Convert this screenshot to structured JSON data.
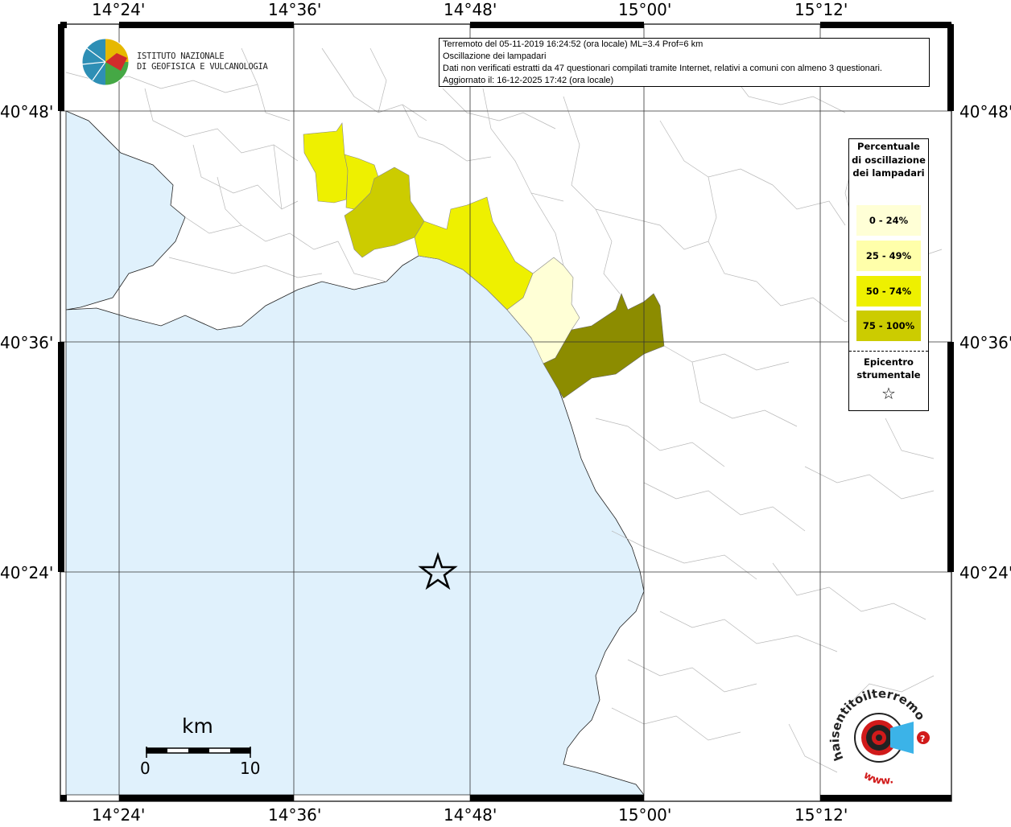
{
  "info": {
    "line1": "Terremoto del 05-11-2019 16:24:52 (ora locale) ML=3.4 Prof=6 km",
    "line2": "Oscillazione dei lampadari",
    "line3": "Dati non verificati estratti da 47 questionari compilati tramite Internet, relativi a comuni con almeno 3 questionari.",
    "line4": "Aggiornato il: 16-12-2025 17:42 (ora locale)"
  },
  "institute": {
    "line1": "ISTITUTO NAZIONALE",
    "line2": "DI GEOFISICA E VULCANOLOGIA"
  },
  "axes": {
    "lon_labels": [
      "14°24'",
      "14°36'",
      "14°48'",
      "15°00'",
      "15°12'"
    ],
    "lat_labels": [
      "40°48'",
      "40°36'",
      "40°24'"
    ]
  },
  "legend": {
    "title": "Percentuale di oscillazione dei lampadari",
    "classes": [
      {
        "label": "0 - 24%",
        "color": "#ffffd6"
      },
      {
        "label": "25 - 49%",
        "color": "#ffffaa"
      },
      {
        "label": "50 - 74%",
        "color": "#eef000"
      },
      {
        "label": "75 - 100%",
        "color": "#cccc00"
      }
    ],
    "epicenter_label": "Epicentro strumentale",
    "epicenter_symbol": "☆"
  },
  "scale_bar": {
    "unit": "km",
    "min": "0",
    "max": "10"
  },
  "colors": {
    "sea": "#e0f1fc",
    "land": "#ffffff",
    "dark_class": "#8c8c00",
    "boundary": "#b8b8b8"
  },
  "branding": {
    "url_text": "haisentitoilterremoto.it",
    "www_text": "www."
  }
}
